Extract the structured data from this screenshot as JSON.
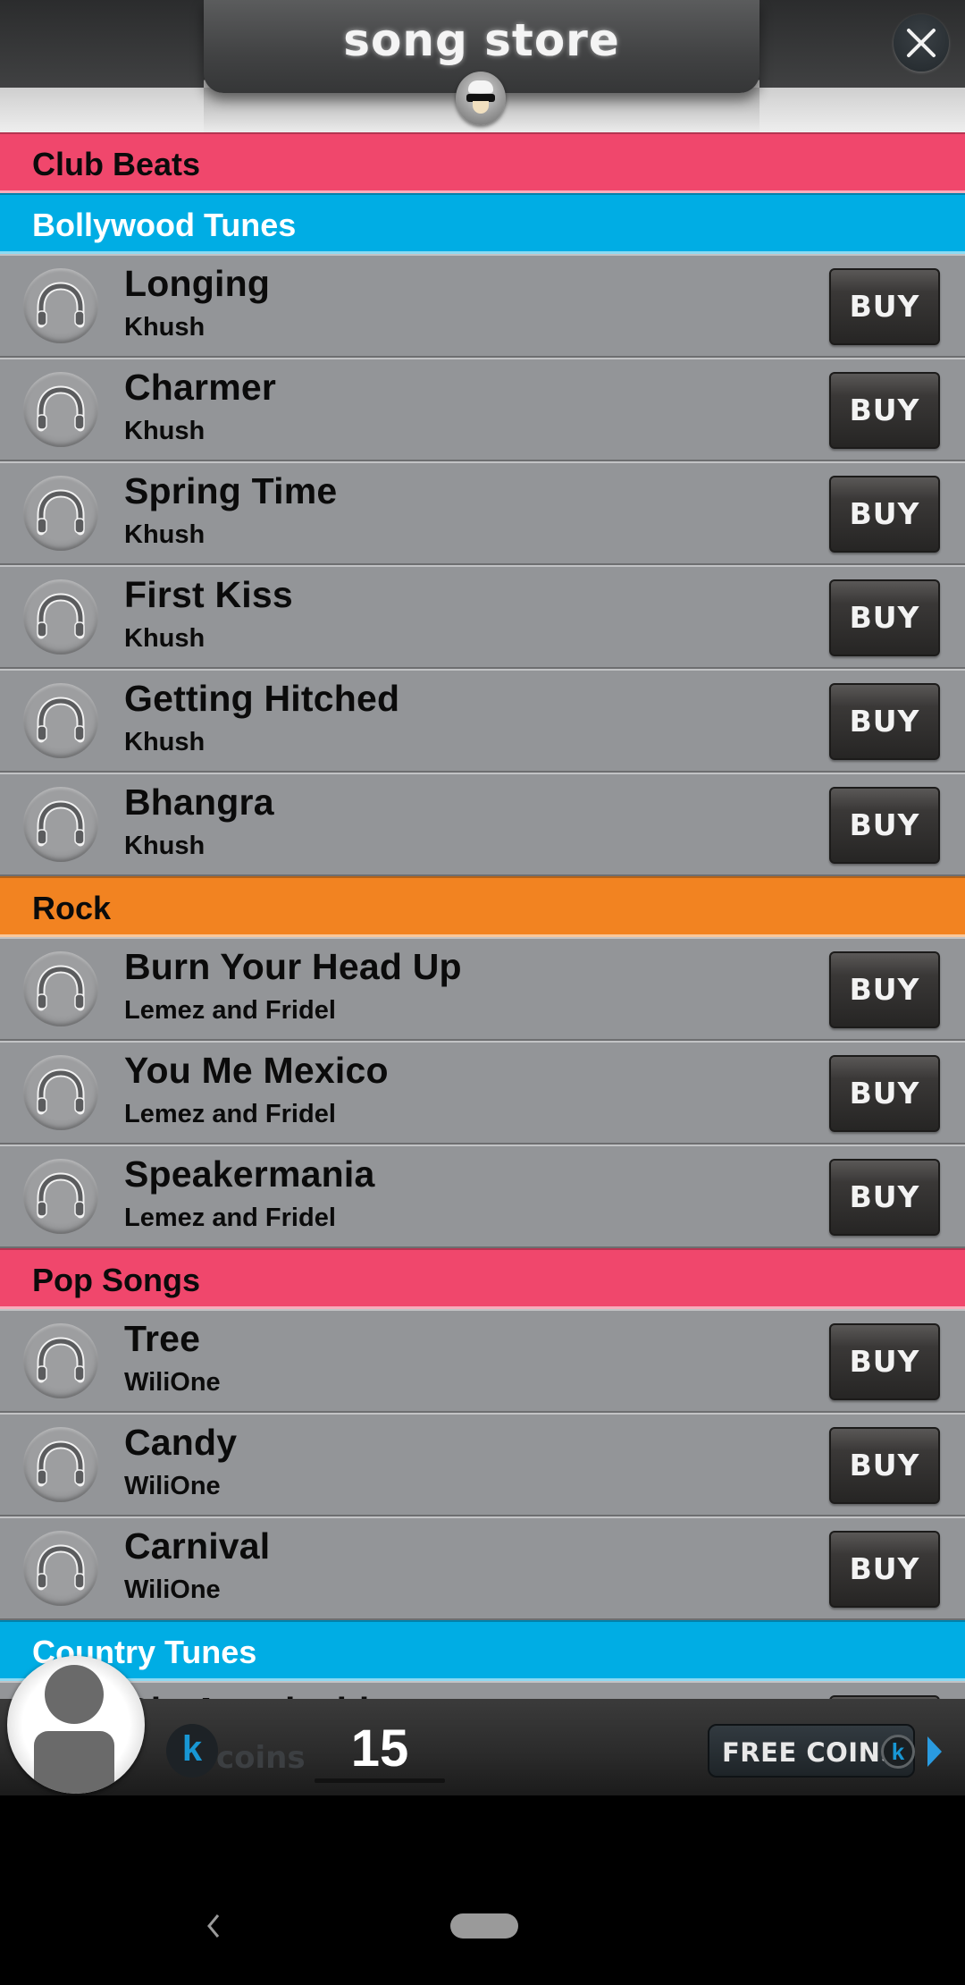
{
  "header": {
    "title": "song store",
    "close_icon": "close-icon",
    "mascot_icon": "mascot-avatar-icon"
  },
  "colors": {
    "pink": "#f0476c",
    "blue": "#00ade4",
    "orange": "#f28321",
    "row_bg": "#939598"
  },
  "sections": [
    {
      "name": "Club Beats",
      "color": "#f0476c",
      "text_color": "#0b0b0b",
      "songs": []
    },
    {
      "name": "Bollywood Tunes",
      "color": "#00ade4",
      "text_color": "#ffffff",
      "songs": [
        {
          "title": "Longing",
          "artist": "Khush",
          "action": "BUY"
        },
        {
          "title": "Charmer",
          "artist": "Khush",
          "action": "BUY"
        },
        {
          "title": "Spring Time",
          "artist": "Khush",
          "action": "BUY"
        },
        {
          "title": "First Kiss",
          "artist": "Khush",
          "action": "BUY"
        },
        {
          "title": "Getting Hitched",
          "artist": "Khush",
          "action": "BUY"
        },
        {
          "title": "Bhangra",
          "artist": "Khush",
          "action": "BUY"
        }
      ]
    },
    {
      "name": "Rock",
      "color": "#f28321",
      "text_color": "#0b0b0b",
      "songs": [
        {
          "title": "Burn Your Head Up",
          "artist": "Lemez and Fridel",
          "action": "BUY"
        },
        {
          "title": "You Me Mexico",
          "artist": "Lemez and Fridel",
          "action": "BUY"
        },
        {
          "title": "Speakermania",
          "artist": "Lemez and Fridel",
          "action": "BUY"
        }
      ]
    },
    {
      "name": "Pop Songs",
      "color": "#f0476c",
      "text_color": "#0b0b0b",
      "songs": [
        {
          "title": "Tree",
          "artist": "WiliOne",
          "action": "BUY"
        },
        {
          "title": "Candy",
          "artist": "WiliOne",
          "action": "BUY"
        },
        {
          "title": "Carnival",
          "artist": "WiliOne",
          "action": "BUY"
        }
      ]
    },
    {
      "name": "Country Tunes",
      "color": "#00ade4",
      "text_color": "#ffffff",
      "songs": [
        {
          "title": "Big Appalachia",
          "artist": "",
          "action": "BUY"
        }
      ]
    }
  ],
  "bottom_bar": {
    "coin_symbol": "k",
    "coins_label": "coins",
    "coin_count": "15",
    "free_coins_label": "FREE COINS",
    "free_coins_symbol": "k"
  },
  "system_nav": {
    "back": "back-icon",
    "home": "home-pill"
  }
}
